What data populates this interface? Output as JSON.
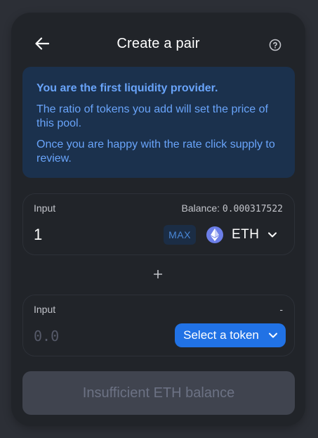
{
  "header": {
    "title": "Create a pair",
    "back_icon": "arrow-left-icon",
    "help_icon": "question-circle-icon"
  },
  "notice": {
    "title": "You are the first liquidity provider.",
    "line1": "The ratio of tokens you add will set the price of this pool.",
    "line2": "Once you are happy with the rate click supply to review."
  },
  "input_a": {
    "label": "Input",
    "balance_label": "Balance:",
    "balance_value": "0.000317522",
    "value": "1",
    "max_label": "MAX",
    "token_symbol": "ETH",
    "token_icon": "ethereum-icon"
  },
  "plus": "+",
  "input_b": {
    "label": "Input",
    "balance_value": "-",
    "placeholder": "0.0",
    "select_label": "Select a token"
  },
  "submit": {
    "label": "Insufficient ETH balance"
  },
  "colors": {
    "page_bg": "#2c2f36",
    "card_bg": "#212429",
    "notice_bg": "#1b314d",
    "notice_text": "#69a4fa",
    "primary": "#2172e5",
    "disabled_bg": "#40444f",
    "disabled_text": "#6c7284"
  }
}
